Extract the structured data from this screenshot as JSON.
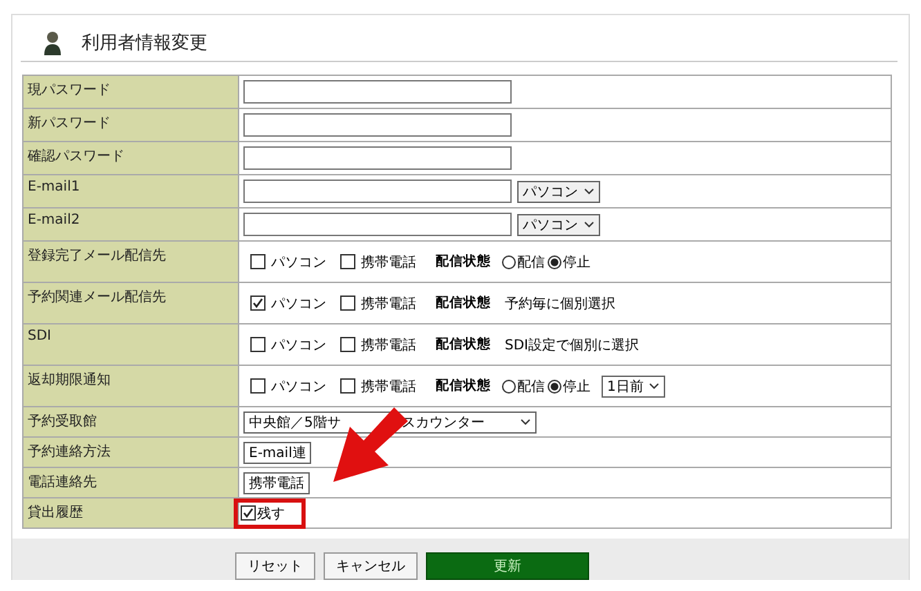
{
  "title": "利用者情報変更",
  "rows": [
    {
      "label": "現パスワード",
      "kind": "input"
    },
    {
      "label": "新パスワード",
      "kind": "input"
    },
    {
      "label": "確認パスワード",
      "kind": "input"
    },
    {
      "label": "E-mail1",
      "kind": "input",
      "select": "パソコン"
    },
    {
      "label": "E-mail2",
      "kind": "input",
      "select": "パソコン"
    },
    {
      "label": "登録完了メール配信先",
      "kind": "delivery",
      "checks": [
        {
          "label": "パソコン",
          "checked": false
        },
        {
          "label": "携帯電話",
          "checked": false
        }
      ],
      "status_label": "配信状態",
      "radios": [
        {
          "label": "配信",
          "selected": false
        },
        {
          "label": "停止",
          "selected": true
        }
      ]
    },
    {
      "label": "予約関連メール配信先",
      "kind": "delivery",
      "checks": [
        {
          "label": "パソコン",
          "checked": true
        },
        {
          "label": "携帯電話",
          "checked": false
        }
      ],
      "status_label": "配信状態",
      "note": "予約毎に個別選択"
    },
    {
      "label": "SDI",
      "kind": "delivery",
      "checks": [
        {
          "label": "パソコン",
          "checked": false
        },
        {
          "label": "携帯電話",
          "checked": false
        }
      ],
      "status_label": "配信状態",
      "note": "SDI設定で個別に選択"
    },
    {
      "label": "返却期限通知",
      "kind": "delivery",
      "checks": [
        {
          "label": "パソコン",
          "checked": false
        },
        {
          "label": "携帯電話",
          "checked": false
        }
      ],
      "status_label": "配信状態",
      "radios": [
        {
          "label": "配信",
          "selected": false
        },
        {
          "label": "停止",
          "selected": true
        }
      ],
      "select": "1日前"
    },
    {
      "label": "予約受取館",
      "kind": "dropdown",
      "parts": [
        "中央館／5階サ",
        "スカウンター"
      ]
    },
    {
      "label": "予約連絡方法",
      "kind": "dropdown",
      "parts": [
        "E-mail連"
      ]
    },
    {
      "label": "電話連絡先",
      "kind": "dropdown",
      "parts": [
        "携帯電話"
      ]
    },
    {
      "label": "貸出履歴",
      "kind": "check",
      "check": {
        "label": "残す",
        "checked": true
      },
      "highlighted": true
    }
  ],
  "buttons": [
    {
      "label": "リセット",
      "kind": "plain"
    },
    {
      "label": "キャンセル",
      "kind": "plain"
    },
    {
      "label": "更新",
      "kind": "primary"
    }
  ]
}
